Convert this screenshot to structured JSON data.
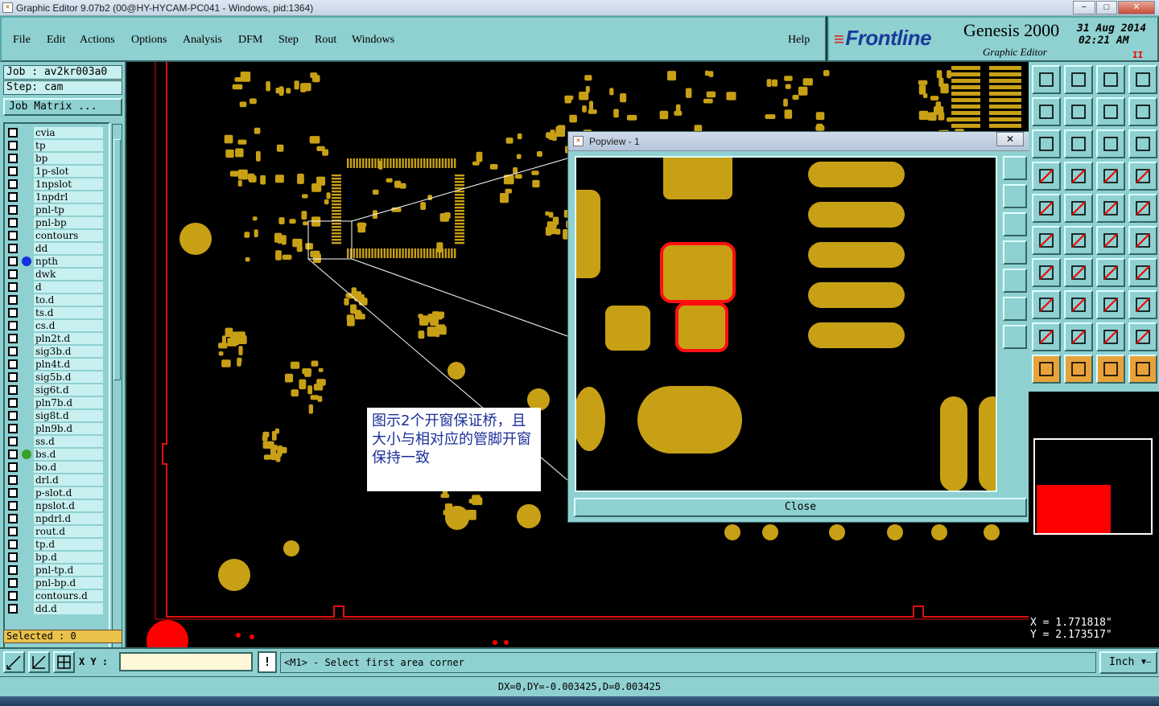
{
  "window": {
    "title": "Graphic Editor 9.07b2 (00@HY-HYCAM-PC041 - Windows, pid:1364)",
    "min_label": "−",
    "max_label": "□",
    "close_label": "✕"
  },
  "menu": {
    "items": [
      {
        "label": "File"
      },
      {
        "label": "Edit"
      },
      {
        "label": "Actions"
      },
      {
        "label": "Options"
      },
      {
        "label": "Analysis"
      },
      {
        "label": "DFM"
      },
      {
        "label": "Step"
      },
      {
        "label": "Rout"
      },
      {
        "label": "Windows"
      }
    ],
    "help": "Help"
  },
  "brand": {
    "logo": "Frontline",
    "product": "Genesis 2000",
    "subtitle": "Graphic Editor",
    "date": "31 Aug 2014",
    "time": "02:21 AM",
    "pause": "II"
  },
  "job": {
    "job_label": "Job : av2kr003a0",
    "step_label": "Step: cam",
    "matrix_button": "Job Matrix ..."
  },
  "layers": [
    {
      "name": "cvia",
      "dot": null
    },
    {
      "name": "tp",
      "dot": null
    },
    {
      "name": "bp",
      "dot": null
    },
    {
      "name": "1p-slot",
      "dot": null
    },
    {
      "name": "1npslot",
      "dot": null
    },
    {
      "name": "1npdrl",
      "dot": null
    },
    {
      "name": "pnl-tp",
      "dot": null
    },
    {
      "name": "pnl-bp",
      "dot": null
    },
    {
      "name": "contours",
      "dot": null
    },
    {
      "name": "dd",
      "dot": null
    },
    {
      "name": "npth",
      "dot": "#1530e0"
    },
    {
      "name": "dwk",
      "dot": null
    },
    {
      "name": "d",
      "dot": null
    },
    {
      "name": "to.d",
      "dot": null
    },
    {
      "name": "ts.d",
      "dot": null
    },
    {
      "name": "cs.d",
      "dot": null
    },
    {
      "name": "pln2t.d",
      "dot": null
    },
    {
      "name": "sig3b.d",
      "dot": null
    },
    {
      "name": "pln4t.d",
      "dot": null
    },
    {
      "name": "sig5b.d",
      "dot": null
    },
    {
      "name": "sig6t.d",
      "dot": null
    },
    {
      "name": "pln7b.d",
      "dot": null
    },
    {
      "name": "sig8t.d",
      "dot": null
    },
    {
      "name": "pln9b.d",
      "dot": null
    },
    {
      "name": "ss.d",
      "dot": null
    },
    {
      "name": "bs.d",
      "dot": "#3aa02a"
    },
    {
      "name": "bo.d",
      "dot": null
    },
    {
      "name": "drl.d",
      "dot": null
    },
    {
      "name": "p-slot.d",
      "dot": null
    },
    {
      "name": "npslot.d",
      "dot": null
    },
    {
      "name": "npdrl.d",
      "dot": null
    },
    {
      "name": "rout.d",
      "dot": null
    },
    {
      "name": "tp.d",
      "dot": null
    },
    {
      "name": "bp.d",
      "dot": null
    },
    {
      "name": "pnl-tp.d",
      "dot": null
    },
    {
      "name": "pnl-bp.d",
      "dot": null
    },
    {
      "name": "contours.d",
      "dot": null
    },
    {
      "name": "dd.d",
      "dot": null
    }
  ],
  "selected": "Selected : 0",
  "popview": {
    "title": "Popview - 1",
    "close_x": "✕",
    "close_button": "Close"
  },
  "annotation": {
    "text": "图示2个开窗保证桥，且大小与相对应的管脚开窗保持一致"
  },
  "coords": {
    "x": "X = 1.771818\"",
    "y": "Y = 2.173517\""
  },
  "bottom": {
    "xy_label": "X Y :",
    "xy_value": "",
    "warn": "!",
    "prompt": "<M1> - Select first area corner",
    "units": "Inch",
    "units_arrow": "▼—"
  },
  "status": "DX=0,DY=-0.003425,D=0.003425",
  "colors": {
    "panel": "#8fd0d0",
    "pad": "#c8a015",
    "highlight": "#ff1010",
    "board_outline": "#e01010"
  }
}
